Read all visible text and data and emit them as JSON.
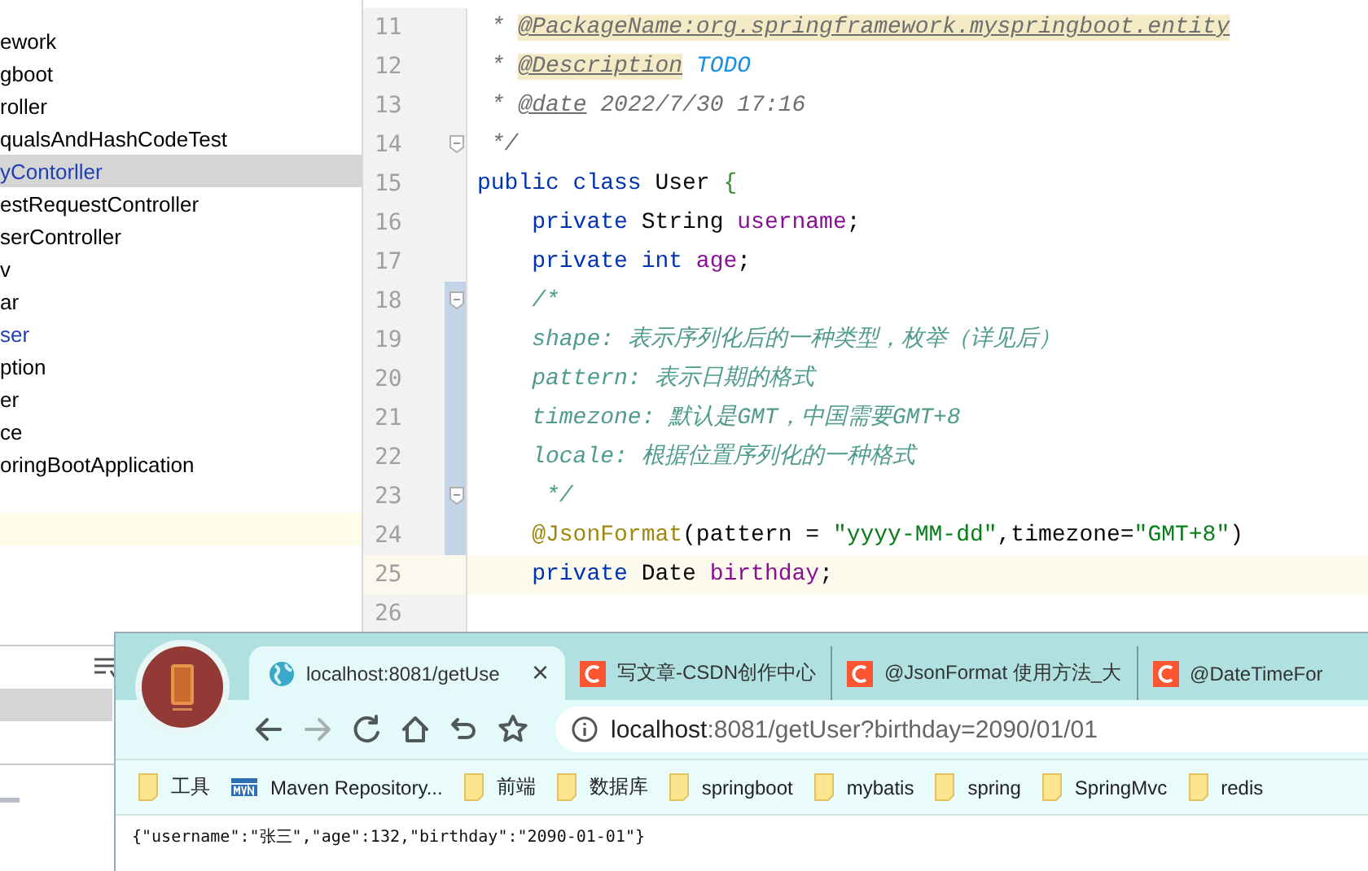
{
  "project_tree": {
    "items": [
      {
        "label": "ework",
        "selected": false,
        "color": "#000000"
      },
      {
        "label": "gboot",
        "selected": false,
        "color": "#000000"
      },
      {
        "label": "roller",
        "selected": false,
        "color": "#000000"
      },
      {
        "label": "qualsAndHashCodeTest",
        "selected": false,
        "color": "#000000"
      },
      {
        "label": "yContorller",
        "selected": true,
        "color": "#2340b0"
      },
      {
        "label": "estRequestController",
        "selected": false,
        "color": "#000000"
      },
      {
        "label": "serController",
        "selected": false,
        "color": "#000000"
      },
      {
        "label": "v",
        "selected": false,
        "color": "#000000"
      },
      {
        "label": "ar",
        "selected": false,
        "color": "#000000"
      },
      {
        "label": "ser",
        "selected": false,
        "color": "#2340b0"
      },
      {
        "label": "ption",
        "selected": false,
        "color": "#000000"
      },
      {
        "label": "er",
        "selected": false,
        "color": "#000000"
      },
      {
        "label": "ce",
        "selected": false,
        "color": "#000000"
      },
      {
        "label": "oringBootApplication",
        "selected": false,
        "color": "#000000"
      }
    ]
  },
  "editor": {
    "lines": [
      {
        "number": "11",
        "fold": false,
        "changed": false,
        "current": false,
        "tokens": [
          {
            "kind": "doc",
            "text": " * "
          },
          {
            "kind": "doctag-hl",
            "text": "@PackageName:org.springframework.myspringboot.entity"
          }
        ]
      },
      {
        "number": "12",
        "fold": false,
        "changed": false,
        "current": false,
        "tokens": [
          {
            "kind": "doc",
            "text": " * "
          },
          {
            "kind": "doctag-hl",
            "text": "@Description"
          },
          {
            "kind": "todo",
            "text": " TODO"
          }
        ]
      },
      {
        "number": "13",
        "fold": false,
        "changed": false,
        "current": false,
        "tokens": [
          {
            "kind": "doc",
            "text": " * "
          },
          {
            "kind": "doctag",
            "text": "@date"
          },
          {
            "kind": "doc",
            "text": " 2022/7/30 17:16"
          }
        ]
      },
      {
        "number": "14",
        "fold": true,
        "changed": false,
        "current": false,
        "tokens": [
          {
            "kind": "doc",
            "text": " */"
          }
        ]
      },
      {
        "number": "15",
        "fold": false,
        "changed": false,
        "current": false,
        "tokens": [
          {
            "kind": "keyword",
            "text": "public class "
          },
          {
            "kind": "plain",
            "text": "User "
          },
          {
            "kind": "brace",
            "text": "{"
          }
        ]
      },
      {
        "number": "16",
        "fold": false,
        "changed": false,
        "current": false,
        "tokens": [
          {
            "kind": "keyword",
            "text": "    private "
          },
          {
            "kind": "plain",
            "text": "String "
          },
          {
            "kind": "field",
            "text": "username"
          },
          {
            "kind": "plain",
            "text": ";"
          }
        ]
      },
      {
        "number": "17",
        "fold": false,
        "changed": false,
        "current": false,
        "tokens": [
          {
            "kind": "keyword",
            "text": "    private int "
          },
          {
            "kind": "field",
            "text": "age"
          },
          {
            "kind": "plain",
            "text": ";"
          }
        ]
      },
      {
        "number": "18",
        "fold": true,
        "changed": true,
        "current": false,
        "tokens": [
          {
            "kind": "comment",
            "text": "    /*"
          }
        ]
      },
      {
        "number": "19",
        "fold": false,
        "changed": true,
        "current": false,
        "tokens": [
          {
            "kind": "comment",
            "text": "    shape: 表示序列化后的一种类型，枚举（详见后）"
          }
        ]
      },
      {
        "number": "20",
        "fold": false,
        "changed": true,
        "current": false,
        "tokens": [
          {
            "kind": "comment",
            "text": "    pattern: 表示日期的格式"
          }
        ]
      },
      {
        "number": "21",
        "fold": false,
        "changed": true,
        "current": false,
        "tokens": [
          {
            "kind": "comment",
            "text": "    timezone: 默认是GMT，中国需要GMT+8"
          }
        ]
      },
      {
        "number": "22",
        "fold": false,
        "changed": true,
        "current": false,
        "tokens": [
          {
            "kind": "comment",
            "text": "    locale: 根据位置序列化的一种格式"
          }
        ]
      },
      {
        "number": "23",
        "fold": true,
        "changed": true,
        "current": false,
        "tokens": [
          {
            "kind": "comment",
            "text": "     */"
          }
        ]
      },
      {
        "number": "24",
        "fold": false,
        "changed": true,
        "current": false,
        "tokens": [
          {
            "kind": "annotation",
            "text": "    @JsonFormat"
          },
          {
            "kind": "plain",
            "text": "(pattern = "
          },
          {
            "kind": "string",
            "text": "\"yyyy-MM-dd\""
          },
          {
            "kind": "plain",
            "text": ",timezone="
          },
          {
            "kind": "string",
            "text": "\"GMT+8\""
          },
          {
            "kind": "plain",
            "text": ")"
          }
        ]
      },
      {
        "number": "25",
        "fold": false,
        "changed": false,
        "current": true,
        "tokens": [
          {
            "kind": "keyword",
            "text": "    private "
          },
          {
            "kind": "plain",
            "text": "Date "
          },
          {
            "kind": "field",
            "text": "birthday"
          },
          {
            "kind": "plain",
            "text": ";"
          }
        ]
      },
      {
        "number": "26",
        "fold": false,
        "changed": false,
        "current": false
      }
    ]
  },
  "browser": {
    "tabs": [
      {
        "kind": "globe",
        "title": "localhost:8081/getUse",
        "selected": true,
        "close": "×"
      },
      {
        "kind": "csdn",
        "title": "写文章-CSDN创作中心",
        "selected": false
      },
      {
        "kind": "csdn",
        "title": "@JsonFormat 使用方法_大",
        "selected": false
      },
      {
        "kind": "csdn",
        "title": "@DateTimeFor",
        "selected": false
      }
    ],
    "nav_buttons": [
      {
        "kind": "back",
        "disabled": false
      },
      {
        "kind": "forward",
        "disabled": true
      },
      {
        "kind": "reload",
        "disabled": false
      },
      {
        "kind": "home",
        "disabled": false
      },
      {
        "kind": "undo",
        "disabled": false
      },
      {
        "kind": "star",
        "disabled": false
      }
    ],
    "address": {
      "host": "localhost",
      "path": ":8081/getUser?birthday=2090/01/01"
    },
    "bookmarks": [
      {
        "kind": "folder",
        "label": "工具"
      },
      {
        "kind": "maven",
        "label": "Maven Repository..."
      },
      {
        "kind": "folder",
        "label": "前端"
      },
      {
        "kind": "folder",
        "label": "数据库"
      },
      {
        "kind": "folder",
        "label": "springboot"
      },
      {
        "kind": "folder",
        "label": "mybatis"
      },
      {
        "kind": "folder",
        "label": "spring"
      },
      {
        "kind": "folder",
        "label": "SpringMvc"
      },
      {
        "kind": "folder",
        "label": "redis"
      }
    ],
    "content": "{\"username\":\"张三\",\"age\":132,\"birthday\":\"2090-01-01\"}"
  }
}
